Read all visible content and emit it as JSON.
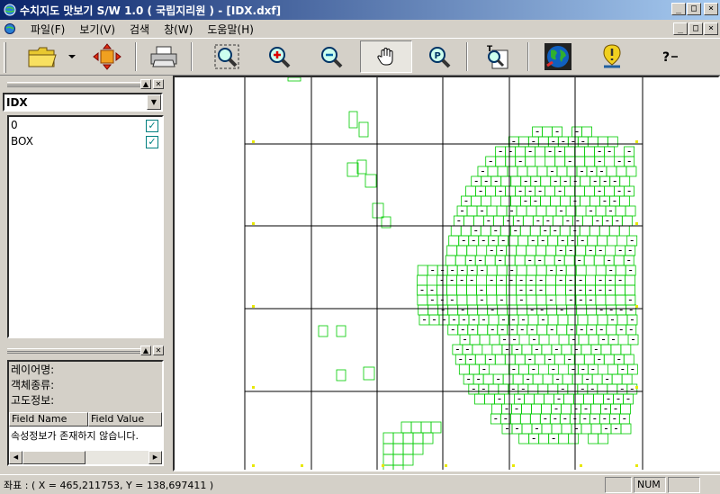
{
  "window": {
    "title": "수치지도 맛보기 S/W  1.0 ( 국립지리원 ) - [IDX.dxf]",
    "controls": {
      "minimize": "_",
      "maximize": "□",
      "close": "×"
    }
  },
  "menu": {
    "items": [
      "파일(F)",
      "보기(V)",
      "검색",
      "창(W)",
      "도움말(H)"
    ]
  },
  "toolbar": {
    "buttons": [
      {
        "name": "open-folder",
        "icon": "folder-icon"
      },
      {
        "name": "open-dropdown",
        "icon": "dropdown-arrow-icon"
      },
      {
        "name": "extent",
        "icon": "move-arrows-icon"
      },
      {
        "name": "print",
        "icon": "printer-icon"
      },
      {
        "name": "zoom-extent",
        "icon": "zoom-box-icon"
      },
      {
        "name": "zoom-in",
        "icon": "zoom-in-icon"
      },
      {
        "name": "zoom-out",
        "icon": "zoom-out-icon"
      },
      {
        "name": "pan",
        "icon": "hand-icon",
        "pressed": true
      },
      {
        "name": "parking-search",
        "icon": "p-magnifier-icon"
      },
      {
        "name": "text-search",
        "icon": "text-magnifier-icon"
      },
      {
        "name": "globe",
        "icon": "globe-icon"
      },
      {
        "name": "alert",
        "icon": "alert-icon"
      },
      {
        "name": "help",
        "icon": "help-icon"
      }
    ]
  },
  "layer_panel": {
    "selected_file": "IDX",
    "layers": [
      {
        "name": "0",
        "checked": true
      },
      {
        "name": "BOX",
        "checked": true
      }
    ]
  },
  "info_panel": {
    "labels": [
      "레이어명:",
      "객체종류:",
      "고도정보:"
    ],
    "columns": [
      "Field Name",
      "Field Value"
    ],
    "message": "속성정보가 존재하지 않습니다."
  },
  "status": {
    "coordinates": "좌표 : ( X = 465,211753, Y = 138,697411 )",
    "num": "NUM"
  },
  "colors": {
    "titlebar": "#0a246a",
    "tile_outline": "#00cc00",
    "grid_line": "#000000",
    "corner_mark": "#e8e800"
  }
}
